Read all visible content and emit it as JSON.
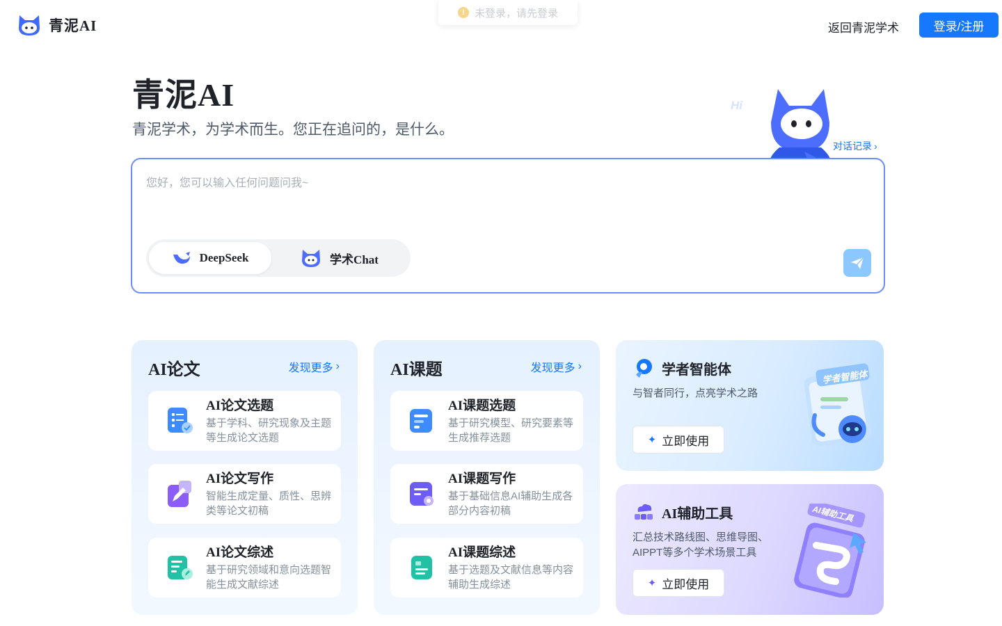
{
  "header": {
    "brand": "青泥AI",
    "toast": "未登录，请先登录",
    "back_link": "返回青泥学术",
    "login_button": "登录/注册"
  },
  "hero": {
    "title": "青泥AI",
    "subtitle": "青泥学术，为学术而生。您正在追问的，是什么。",
    "mascot_greeting": "Hi",
    "history_link": "对话记录"
  },
  "chat": {
    "placeholder": "您好，您可以输入任何问题问我~",
    "models": [
      {
        "label": "DeepSeek",
        "icon": "deepseek-whale-icon",
        "selected": true
      },
      {
        "label": "学术Chat",
        "icon": "cat-mascot-icon",
        "selected": false
      }
    ],
    "send_icon": "paper-plane-icon"
  },
  "paper_card": {
    "title": "AI论文",
    "more": "发现更多",
    "items": [
      {
        "title": "AI论文选题",
        "desc": "基于学科、研究现象及主题等生成论文选题",
        "icon": "document-check-icon"
      },
      {
        "title": "AI论文写作",
        "desc": "智能生成定量、质性、思辨类等论文初稿",
        "icon": "pen-write-icon"
      },
      {
        "title": "AI论文综述",
        "desc": "基于研究领域和意向选题智能生成文献综述",
        "icon": "document-edit-icon"
      }
    ]
  },
  "topic_card": {
    "title": "AI课题",
    "more": "发现更多",
    "items": [
      {
        "title": "AI课题选题",
        "desc": "基于研究模型、研究要素等生成推荐选题",
        "icon": "topic-select-icon"
      },
      {
        "title": "AI课题写作",
        "desc": "基于基础信息AI辅助生成各部分内容初稿",
        "icon": "topic-write-icon"
      },
      {
        "title": "AI课题综述",
        "desc": "基于选题及文献信息等内容辅助生成综述",
        "icon": "topic-review-icon"
      }
    ]
  },
  "scholar_card": {
    "title": "学者智能体",
    "desc": "与智者同行，点亮学术之路",
    "button": "立即使用",
    "illus_label": "学者智能体"
  },
  "tools_card": {
    "title": "AI辅助工具",
    "desc": "汇总技术路线图、思维导图、AIPPT等多个学术场景工具",
    "button": "立即使用",
    "illus_label": "AI辅助工具"
  },
  "colors": {
    "primary": "#1677ff",
    "border": "#6b8cff",
    "send": "#8cc8ff"
  }
}
